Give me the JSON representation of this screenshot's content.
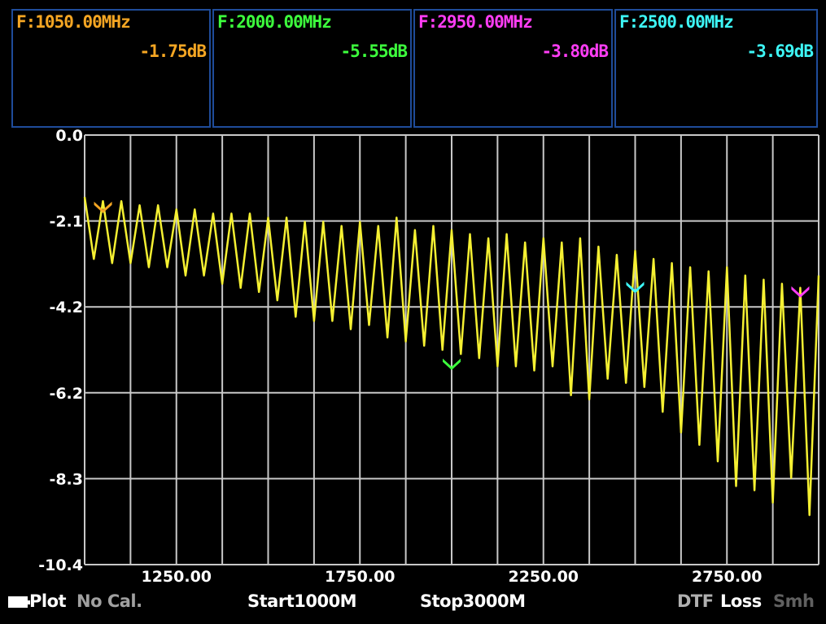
{
  "markers": [
    {
      "freq_label": "F:1050.00MHz",
      "value_label": "-1.75dB",
      "color": "#f5a623",
      "freq_mhz": 1050,
      "db": -1.75
    },
    {
      "freq_label": "F:2000.00MHz",
      "value_label": "-5.55dB",
      "color": "#3dff3d",
      "freq_mhz": 2000,
      "db": -5.55
    },
    {
      "freq_label": "F:2950.00MHz",
      "value_label": "-3.80dB",
      "color": "#ff3df5",
      "freq_mhz": 2950,
      "db": -3.8
    },
    {
      "freq_label": "F:2500.00MHz",
      "value_label": "-3.69dB",
      "color": "#3df5f5",
      "freq_mhz": 2500,
      "db": -3.69
    }
  ],
  "status": {
    "plot": "Plot",
    "cal": "No Cal.",
    "start": "Start1000M",
    "stop": "Stop3000M",
    "dtf": "DTF",
    "loss": "Loss",
    "smith": "Smh"
  },
  "colors": {
    "grid": "#c8c8c8",
    "trace": "#f5f032",
    "panel_border": "#1f4c9a",
    "cal_text": "#a0a0a0",
    "dtf_text": "#b0b0b0",
    "smith_text": "#606060"
  },
  "chart_data": {
    "type": "line",
    "title": "",
    "xlabel": "",
    "ylabel": "",
    "xlim": [
      1000,
      3000
    ],
    "ylim": [
      -10.4,
      0.0
    ],
    "y_ticks": [
      "0.0",
      "-2.1",
      "-4.2",
      "-6.2",
      "-8.3",
      "-10.4"
    ],
    "x_ticks": [
      "1250.00",
      "1750.00",
      "2250.00",
      "2750.00"
    ],
    "x_tick_values": [
      1250,
      1750,
      2250,
      2750
    ],
    "grid": true,
    "series": [
      {
        "x": [
          1000,
          1025,
          1050,
          1075,
          1100,
          1125,
          1150,
          1175,
          1200,
          1225,
          1250,
          1275,
          1300,
          1325,
          1350,
          1375,
          1400,
          1425,
          1450,
          1475,
          1500,
          1525,
          1550,
          1575,
          1600,
          1625,
          1650,
          1675,
          1700,
          1725,
          1750,
          1775,
          1800,
          1825,
          1850,
          1875,
          1900,
          1925,
          1950,
          1975,
          2000,
          2025,
          2050,
          2075,
          2100,
          2125,
          2150,
          2175,
          2200,
          2225,
          2250,
          2275,
          2300,
          2325,
          2350,
          2375,
          2400,
          2425,
          2450,
          2475,
          2500,
          2525,
          2550,
          2575,
          2600,
          2625,
          2650,
          2675,
          2700,
          2725,
          2750,
          2775,
          2800,
          2825,
          2850,
          2875,
          2900,
          2925,
          2950,
          2975,
          3000
        ],
        "y": [
          -1.5,
          -3.0,
          -1.6,
          -3.1,
          -1.6,
          -3.1,
          -1.7,
          -3.2,
          -1.7,
          -3.2,
          -1.8,
          -3.4,
          -1.8,
          -3.4,
          -1.9,
          -3.6,
          -1.9,
          -3.7,
          -1.9,
          -3.8,
          -2.0,
          -4.0,
          -2.0,
          -4.4,
          -2.1,
          -4.5,
          -2.1,
          -4.5,
          -2.2,
          -4.7,
          -2.1,
          -4.6,
          -2.2,
          -4.9,
          -2.0,
          -5.0,
          -2.3,
          -5.1,
          -2.2,
          -5.2,
          -2.3,
          -5.3,
          -2.4,
          -5.4,
          -2.5,
          -5.6,
          -2.4,
          -5.6,
          -2.6,
          -5.7,
          -2.5,
          -5.6,
          -2.6,
          -6.3,
          -2.5,
          -6.4,
          -2.7,
          -5.9,
          -2.9,
          -6.0,
          -2.8,
          -6.1,
          -3.0,
          -6.7,
          -3.1,
          -7.2,
          -3.2,
          -7.5,
          -3.3,
          -7.9,
          -3.2,
          -8.5,
          -3.4,
          -8.6,
          -3.5,
          -8.9,
          -3.6,
          -8.3,
          -3.7,
          -9.2,
          -3.4
        ]
      }
    ]
  }
}
